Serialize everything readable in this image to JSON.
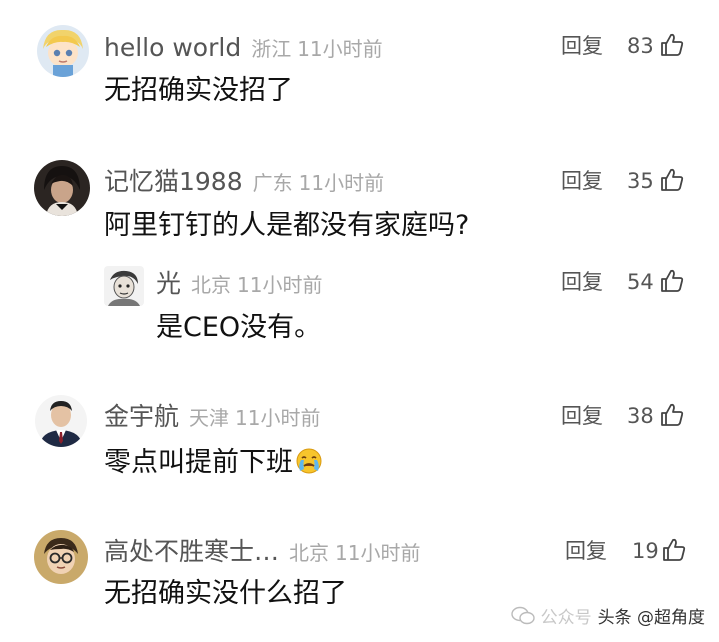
{
  "comments": [
    {
      "username": "hello world",
      "location": "浙江",
      "time": "11小时前",
      "text": "无招确实没招了",
      "reply_label": "回复",
      "likes": "83",
      "avatar_icon": "cartoon-boy-avatar"
    },
    {
      "username": "记忆猫1988",
      "location": "广东",
      "time": "11小时前",
      "text": "阿里钉钉的人是都没有家庭吗?",
      "reply_label": "回复",
      "likes": "35",
      "avatar_icon": "person-photo-avatar"
    },
    {
      "username": "光",
      "location": "北京",
      "time": "11小时前",
      "text": "是CEO没有。",
      "reply_label": "回复",
      "likes": "54",
      "avatar_icon": "sketch-portrait-avatar",
      "is_reply": true
    },
    {
      "username": "金宇航",
      "location": "天津",
      "time": "11小时前",
      "text": "零点叫提前下班",
      "reply_label": "回复",
      "likes": "38",
      "avatar_icon": "businessman-avatar",
      "emoji": "crying-face-emoji"
    },
    {
      "username": "高处不胜寒士…",
      "location": "北京",
      "time": "11小时前",
      "text": "无招确实没什么招了",
      "reply_label": "回复",
      "likes": "19",
      "avatar_icon": "glasses-cartoon-avatar"
    }
  ],
  "watermark": {
    "faint_text": "公众号",
    "main_text": "头条 @超角度",
    "icon": "wechat-icon"
  },
  "colors": {
    "username": "#555555",
    "meta": "#a8a8a8",
    "body": "#111111"
  }
}
